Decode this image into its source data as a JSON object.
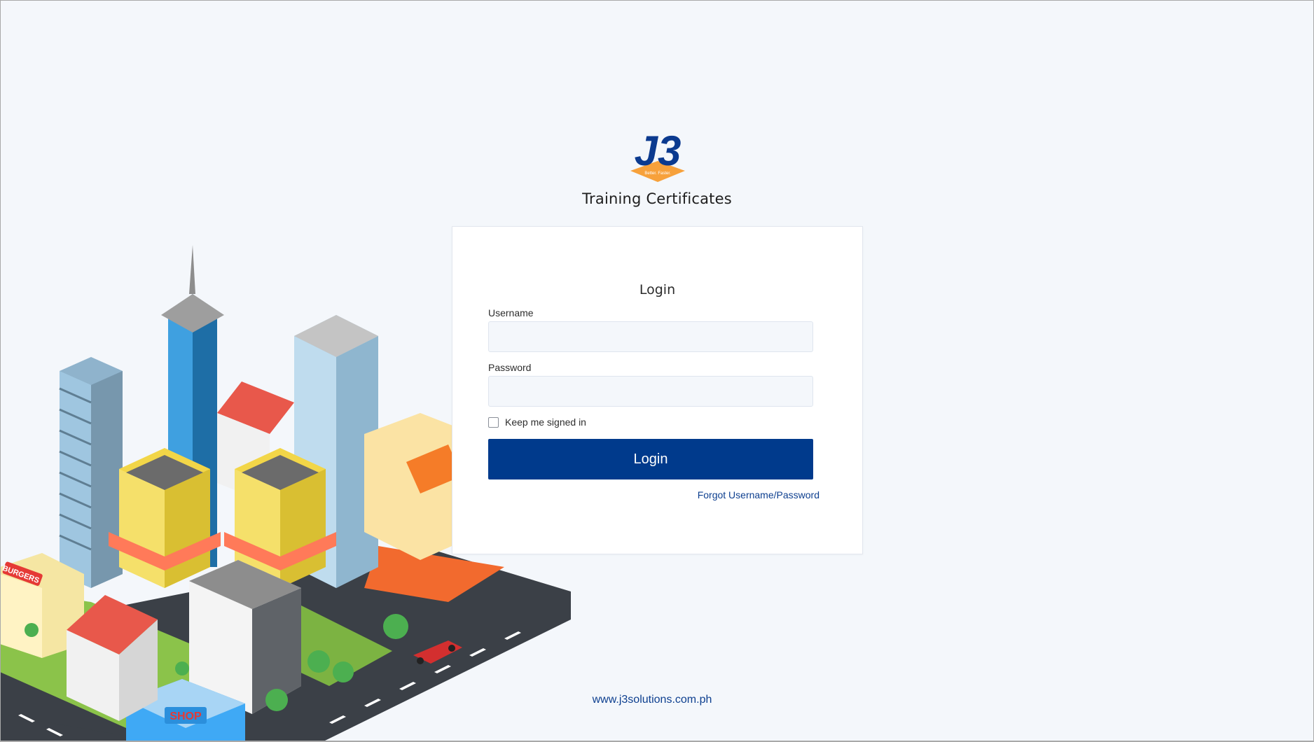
{
  "app": {
    "title": "Training Certificates",
    "logo_text": "J3",
    "logo_tagline": "Better. Faster."
  },
  "login": {
    "heading": "Login",
    "username_label": "Username",
    "username_value": "",
    "password_label": "Password",
    "password_value": "",
    "keep_signed_in_label": "Keep me signed in",
    "keep_signed_in_checked": false,
    "submit_label": "Login",
    "forgot_link": "Forgot Username/Password"
  },
  "footer": {
    "website": "www.j3solutions.com.ph"
  },
  "illustration": {
    "shop_sign": "SHOP",
    "burger_sign": "BURGERS"
  },
  "colors": {
    "primary": "#003a8c",
    "link": "#0d3f8f",
    "background": "#f4f7fb",
    "logo_orange": "#f7a13b"
  },
  "icons": [
    "company-logo",
    "checkbox-icon"
  ]
}
